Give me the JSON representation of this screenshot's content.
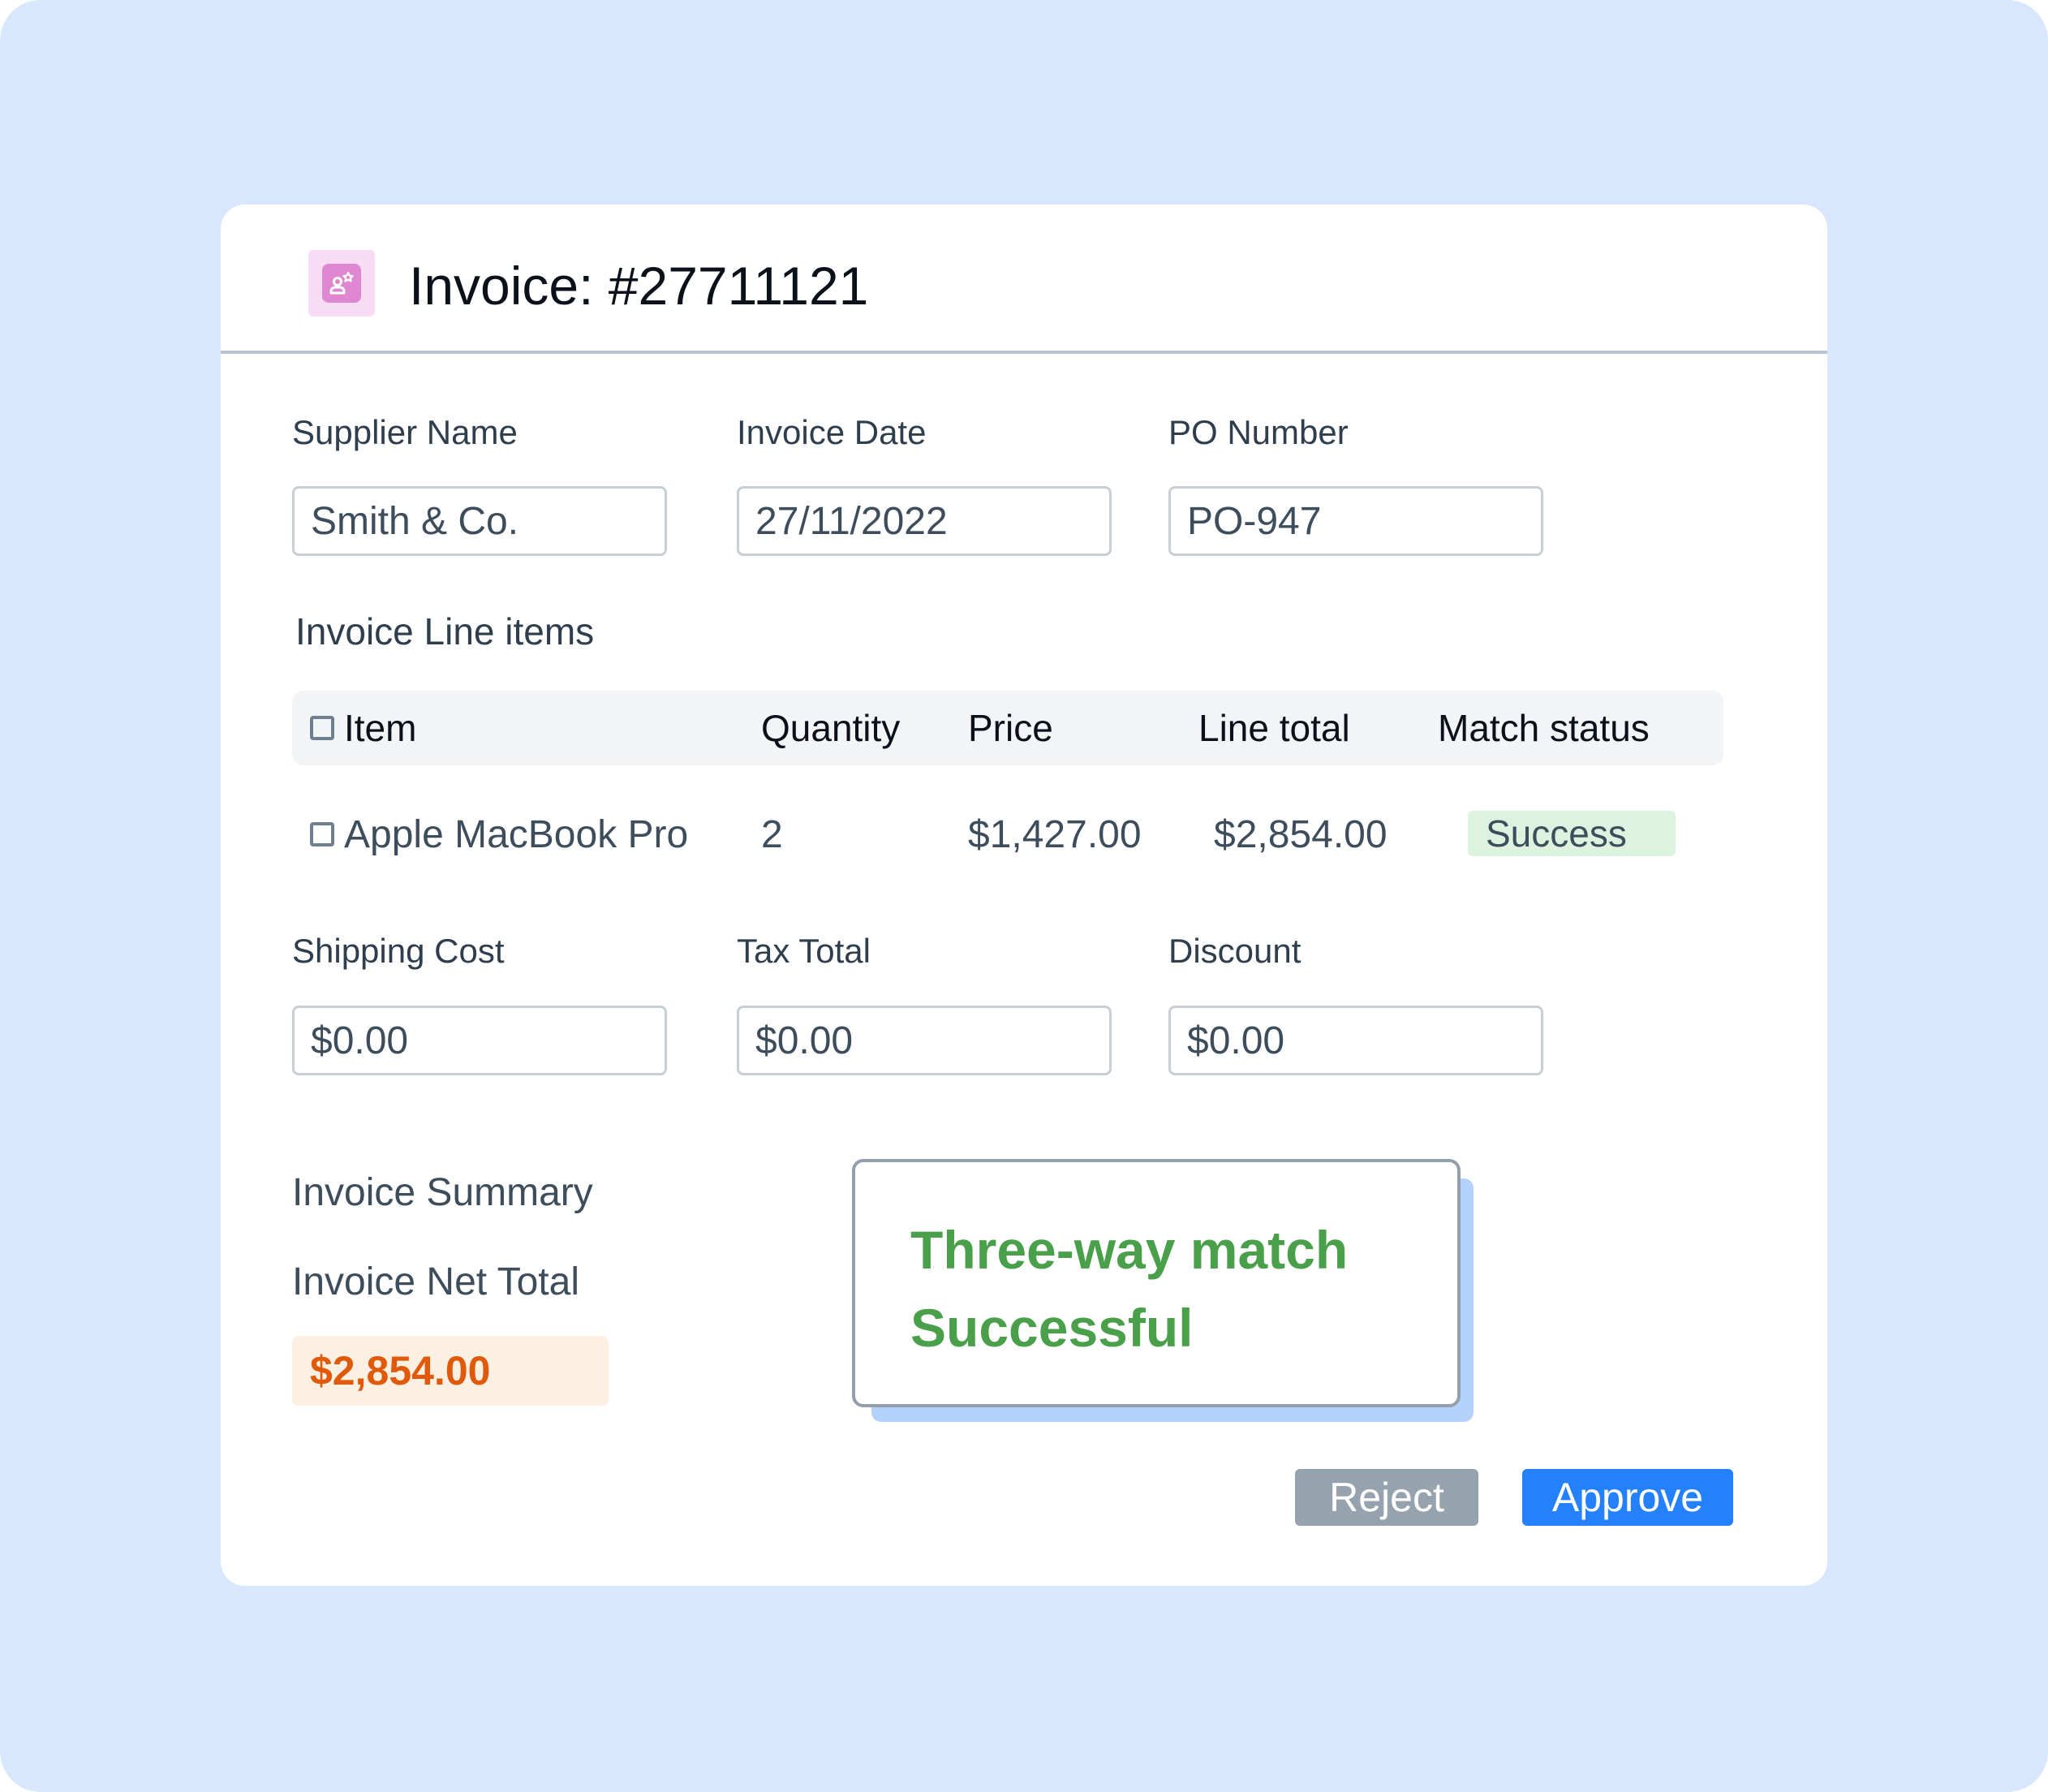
{
  "header": {
    "title": "Invoice: #27711121",
    "icon": "user-sparkle-icon"
  },
  "fields_top": [
    {
      "label": "Supplier Name",
      "value": "Smith & Co."
    },
    {
      "label": "Invoice Date",
      "value": "27/11/2022"
    },
    {
      "label": "PO Number",
      "value": "PO-947"
    }
  ],
  "line_items": {
    "title": "Invoice Line items",
    "columns": [
      "Item",
      "Quantity",
      "Price",
      "Line total",
      "Match status"
    ],
    "rows": [
      {
        "item": "Apple MacBook Pro",
        "quantity": "2",
        "price": "$1,427.00",
        "line_total": "$2,854.00",
        "match_status": "Success"
      }
    ]
  },
  "fields_bottom": [
    {
      "label": "Shipping Cost",
      "value": "$0.00"
    },
    {
      "label": "Tax Total",
      "value": "$0.00"
    },
    {
      "label": "Discount",
      "value": "$0.00"
    }
  ],
  "summary": {
    "title": "Invoice Summary",
    "net_total_label": "Invoice Net Total",
    "net_total_value": "$2,854.00"
  },
  "match_result": {
    "line1": "Three-way match",
    "line2": "Successful"
  },
  "actions": {
    "reject_label": "Reject",
    "approve_label": "Approve"
  },
  "colors": {
    "background": "#d8e7fd",
    "approve": "#2481fb",
    "reject": "#96a3af",
    "success_badge": "#dcf4df",
    "success_text": "#4aa04a",
    "net_total_text": "#e05a0c",
    "net_total_bg": "#fcf0e2",
    "icon_accent": "#e087d2"
  }
}
